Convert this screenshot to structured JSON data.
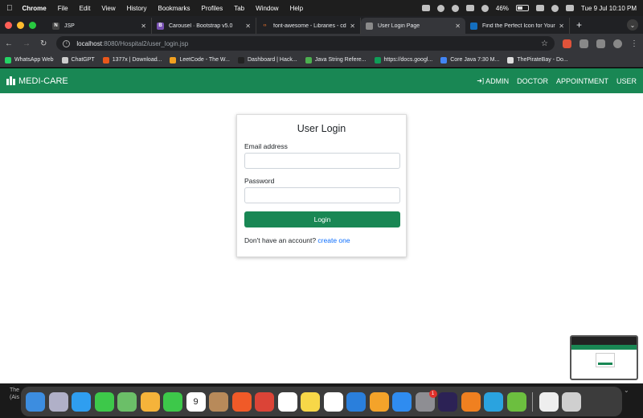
{
  "menubar": {
    "app": "Chrome",
    "items": [
      "File",
      "Edit",
      "View",
      "History",
      "Bookmarks",
      "Profiles",
      "Tab",
      "Window",
      "Help"
    ],
    "battery": "46%",
    "battery_level": 0.46,
    "clock": "Tue 9 Jul  10:10 PM"
  },
  "tabs": [
    {
      "title": "JSP",
      "favicon": "N",
      "color": "#444444"
    },
    {
      "title": "Carousel · Bootstrap v5.0",
      "favicon": "B",
      "color": "#7952b3"
    },
    {
      "title": "font-awesome - Libraries - cd",
      "favicon": "‹›",
      "color": "#e8712b"
    },
    {
      "title": "User Login Page",
      "favicon": "",
      "color": "#8a8a8a"
    },
    {
      "title": "Find the Perfect Icon for Your",
      "favicon": "",
      "color": "#146ebe"
    }
  ],
  "address": {
    "host": "localhost",
    "path": ":8080/Hospital2/user_login.jsp"
  },
  "bookmarks": [
    {
      "label": "WhatsApp Web",
      "color": "#25d366"
    },
    {
      "label": "ChatGPT",
      "color": "#cccccc"
    },
    {
      "label": "1377x | Download...",
      "color": "#e8581c"
    },
    {
      "label": "LeetCode - The W...",
      "color": "#f0a020"
    },
    {
      "label": "Dashboard | Hack...",
      "color": "#222222"
    },
    {
      "label": "Java String Refere...",
      "color": "#4caf50"
    },
    {
      "label": "https://docs.googl...",
      "color": "#0f9d58"
    },
    {
      "label": "Core Java 7:30 M...",
      "color": "#4285f4"
    },
    {
      "label": "ThePirateBay - Do...",
      "color": "#dddddd"
    }
  ],
  "site": {
    "brand": "MEDI-CARE",
    "nav": [
      "ADMIN",
      "DOCTOR",
      "APPOINTMENT",
      "USER"
    ]
  },
  "login": {
    "heading": "User Login",
    "email_label": "Email address",
    "email_value": "",
    "password_label": "Password",
    "password_value": "",
    "button": "Login",
    "signup_text": "Don't have an account?",
    "signup_link": "create one"
  },
  "dock": {
    "apps": [
      {
        "name": "finder-icon",
        "color": "#3c8de0"
      },
      {
        "name": "launchpad-icon",
        "color": "#b0b0c8"
      },
      {
        "name": "safari-icon",
        "color": "#2f9ef0"
      },
      {
        "name": "messages-icon",
        "color": "#3dc84a"
      },
      {
        "name": "maps-icon",
        "color": "#6bbf68"
      },
      {
        "name": "photos-icon",
        "color": "#f5b33a"
      },
      {
        "name": "facetime-icon",
        "color": "#3dc84a"
      },
      {
        "name": "calendar-icon",
        "color": "#ffffff",
        "text": "9"
      },
      {
        "name": "contacts-icon",
        "color": "#b88a5a"
      },
      {
        "name": "brave-icon",
        "color": "#f05a28"
      },
      {
        "name": "chrome-icon",
        "color": "#db4437"
      },
      {
        "name": "reminders-icon",
        "color": "#ffffff"
      },
      {
        "name": "notes-icon",
        "color": "#f7d748"
      },
      {
        "name": "freeform-icon",
        "color": "#ffffff"
      },
      {
        "name": "keynote-icon",
        "color": "#2a7fdc"
      },
      {
        "name": "pages-icon",
        "color": "#f4a32a"
      },
      {
        "name": "app-store-icon",
        "color": "#2f8cf0"
      },
      {
        "name": "system-settings-icon",
        "color": "#8e8e93",
        "badge": "1"
      },
      {
        "name": "eclipse-icon",
        "color": "#2c2255"
      },
      {
        "name": "vlc-icon",
        "color": "#f08020"
      },
      {
        "name": "telegram-icon",
        "color": "#2aa3df"
      },
      {
        "name": "utorrent-icon",
        "color": "#6cbf3f"
      },
      {
        "name": "preview-icon",
        "color": "#eeeeee"
      },
      {
        "name": "trash-icon",
        "color": "#cfcfcf"
      }
    ]
  },
  "desk_text": [
    "The",
    "(Ais"
  ],
  "colors": {
    "brand": "#198754",
    "link": "#0d6efd"
  }
}
